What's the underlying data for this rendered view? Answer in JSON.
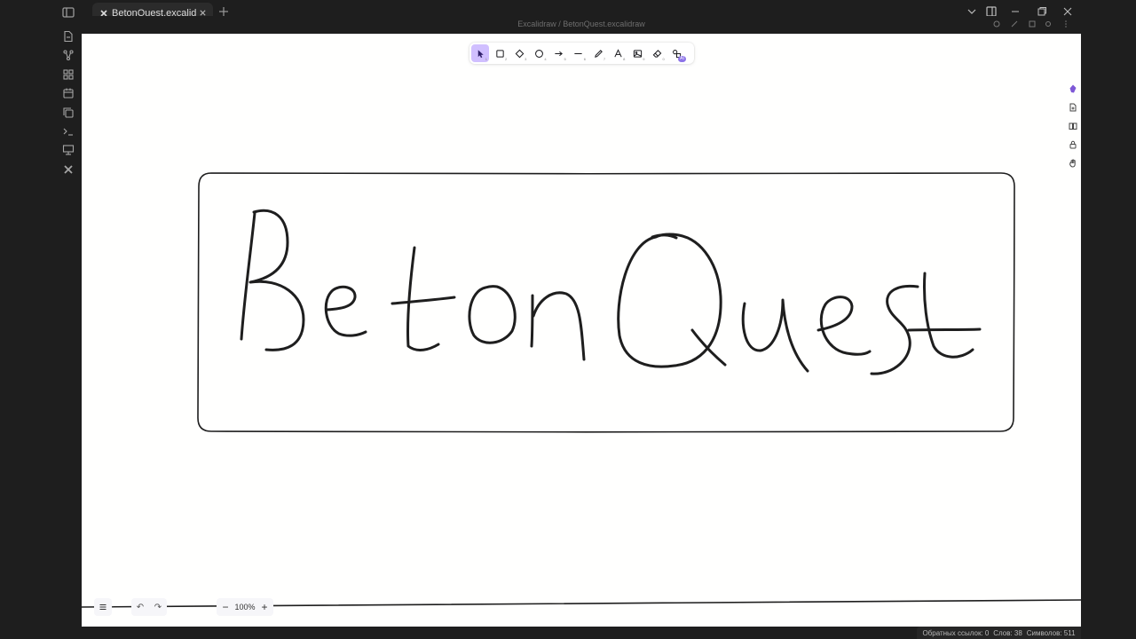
{
  "window": {
    "tab_title": "BetonQuest.excalidraw",
    "breadcrumb": "Excalidraw / BetonQuest.excalidraw"
  },
  "toolbar": {
    "tools": [
      {
        "name": "selection",
        "num": "1"
      },
      {
        "name": "rectangle",
        "num": "2"
      },
      {
        "name": "diamond",
        "num": "3"
      },
      {
        "name": "ellipse",
        "num": "4"
      },
      {
        "name": "arrow",
        "num": "5"
      },
      {
        "name": "line",
        "num": "6"
      },
      {
        "name": "draw",
        "num": "7"
      },
      {
        "name": "text",
        "num": "8"
      },
      {
        "name": "image",
        "num": "9"
      },
      {
        "name": "eraser",
        "num": "0"
      },
      {
        "name": "ai",
        "num": ""
      }
    ],
    "active_tool": "selection",
    "ai_badge": "AI"
  },
  "canvas": {
    "drawing_text": "BetonQuest",
    "background": "#fffffe",
    "stroke_color": "#1e1e1e"
  },
  "bottom": {
    "zoom_label": "100%",
    "zoom_out": "−",
    "zoom_in": "+",
    "undo": "↶",
    "redo": "↷"
  },
  "status": {
    "backlinks": "Обратных ссылок: 0",
    "words": "Слов: 38",
    "chars": "Символов: 511"
  },
  "colors": {
    "accent": "#d0bfff",
    "ai_badge": "#8d74e8"
  }
}
